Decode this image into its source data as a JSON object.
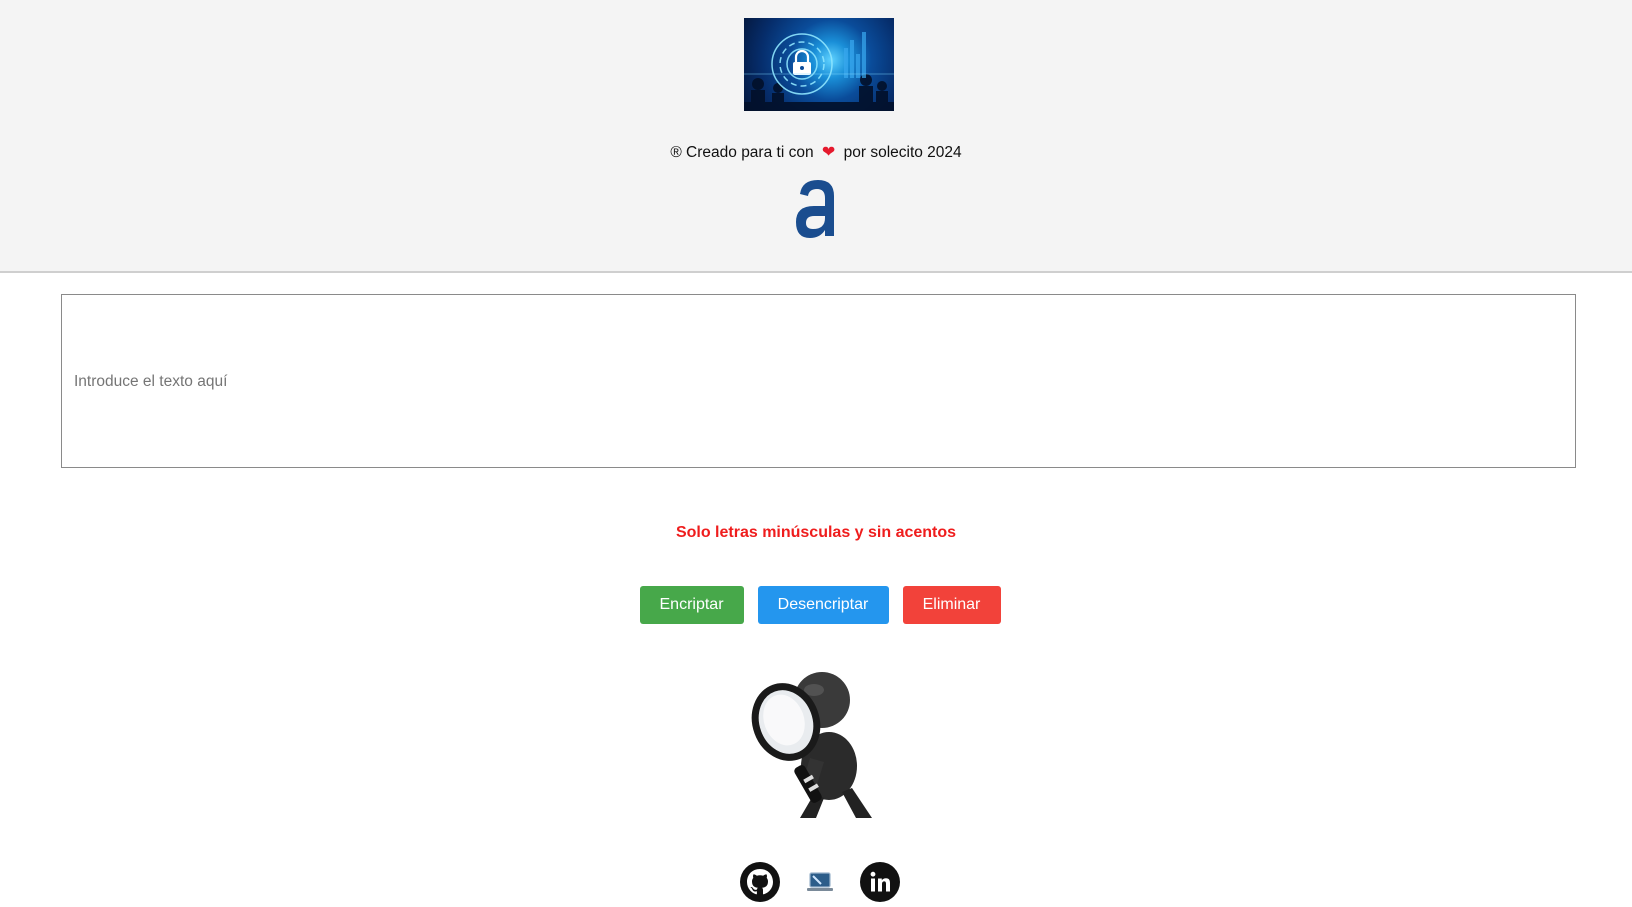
{
  "header": {
    "banner_icon": "cyber-security-lock-banner",
    "credit_prefix": "®",
    "credit_text_before": "Creado para ti con",
    "credit_heart": "❤",
    "credit_text_after": "por solecito 2024",
    "brand_logo_icon": "brand-a-logo"
  },
  "main": {
    "input_placeholder": "Introduce el texto aquí",
    "input_value": "",
    "warning": "Solo letras minúsculas y sin acentos",
    "buttons": {
      "encrypt": "Encriptar",
      "decrypt": "Desencriptar",
      "delete": "Eliminar"
    },
    "figure_icon": "magnifying-glass-figure"
  },
  "footer": {
    "social": [
      "github-icon",
      "portfolio-icon",
      "linkedin-icon"
    ]
  },
  "colors": {
    "header_bg": "#f4f4f4",
    "warning": "#ef1d1d",
    "encrypt": "#47a84a",
    "decrypt": "#2496ee",
    "delete": "#f2423a",
    "brand_blue": "#1a4d8f"
  }
}
